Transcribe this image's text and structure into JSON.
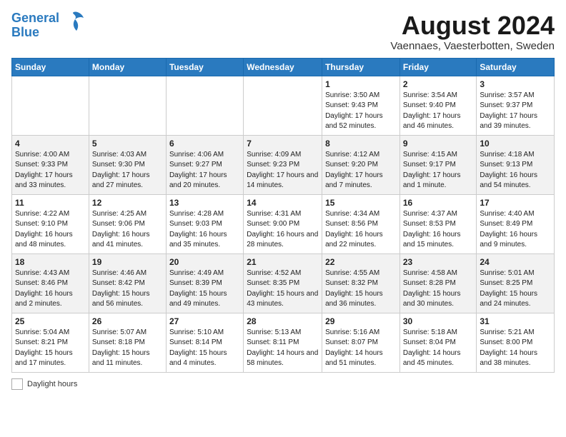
{
  "logo": {
    "line1": "General",
    "line2": "Blue",
    "symbol": "▶"
  },
  "title": "August 2024",
  "location": "Vaennaes, Vaesterbotten, Sweden",
  "days_of_week": [
    "Sunday",
    "Monday",
    "Tuesday",
    "Wednesday",
    "Thursday",
    "Friday",
    "Saturday"
  ],
  "weeks": [
    [
      {
        "day": "",
        "content": ""
      },
      {
        "day": "",
        "content": ""
      },
      {
        "day": "",
        "content": ""
      },
      {
        "day": "",
        "content": ""
      },
      {
        "day": "1",
        "content": "Sunrise: 3:50 AM\nSunset: 9:43 PM\nDaylight: 17 hours\nand 52 minutes."
      },
      {
        "day": "2",
        "content": "Sunrise: 3:54 AM\nSunset: 9:40 PM\nDaylight: 17 hours\nand 46 minutes."
      },
      {
        "day": "3",
        "content": "Sunrise: 3:57 AM\nSunset: 9:37 PM\nDaylight: 17 hours\nand 39 minutes."
      }
    ],
    [
      {
        "day": "4",
        "content": "Sunrise: 4:00 AM\nSunset: 9:33 PM\nDaylight: 17 hours\nand 33 minutes."
      },
      {
        "day": "5",
        "content": "Sunrise: 4:03 AM\nSunset: 9:30 PM\nDaylight: 17 hours\nand 27 minutes."
      },
      {
        "day": "6",
        "content": "Sunrise: 4:06 AM\nSunset: 9:27 PM\nDaylight: 17 hours\nand 20 minutes."
      },
      {
        "day": "7",
        "content": "Sunrise: 4:09 AM\nSunset: 9:23 PM\nDaylight: 17 hours\nand 14 minutes."
      },
      {
        "day": "8",
        "content": "Sunrise: 4:12 AM\nSunset: 9:20 PM\nDaylight: 17 hours\nand 7 minutes."
      },
      {
        "day": "9",
        "content": "Sunrise: 4:15 AM\nSunset: 9:17 PM\nDaylight: 17 hours\nand 1 minute."
      },
      {
        "day": "10",
        "content": "Sunrise: 4:18 AM\nSunset: 9:13 PM\nDaylight: 16 hours\nand 54 minutes."
      }
    ],
    [
      {
        "day": "11",
        "content": "Sunrise: 4:22 AM\nSunset: 9:10 PM\nDaylight: 16 hours\nand 48 minutes."
      },
      {
        "day": "12",
        "content": "Sunrise: 4:25 AM\nSunset: 9:06 PM\nDaylight: 16 hours\nand 41 minutes."
      },
      {
        "day": "13",
        "content": "Sunrise: 4:28 AM\nSunset: 9:03 PM\nDaylight: 16 hours\nand 35 minutes."
      },
      {
        "day": "14",
        "content": "Sunrise: 4:31 AM\nSunset: 9:00 PM\nDaylight: 16 hours\nand 28 minutes."
      },
      {
        "day": "15",
        "content": "Sunrise: 4:34 AM\nSunset: 8:56 PM\nDaylight: 16 hours\nand 22 minutes."
      },
      {
        "day": "16",
        "content": "Sunrise: 4:37 AM\nSunset: 8:53 PM\nDaylight: 16 hours\nand 15 minutes."
      },
      {
        "day": "17",
        "content": "Sunrise: 4:40 AM\nSunset: 8:49 PM\nDaylight: 16 hours\nand 9 minutes."
      }
    ],
    [
      {
        "day": "18",
        "content": "Sunrise: 4:43 AM\nSunset: 8:46 PM\nDaylight: 16 hours\nand 2 minutes."
      },
      {
        "day": "19",
        "content": "Sunrise: 4:46 AM\nSunset: 8:42 PM\nDaylight: 15 hours\nand 56 minutes."
      },
      {
        "day": "20",
        "content": "Sunrise: 4:49 AM\nSunset: 8:39 PM\nDaylight: 15 hours\nand 49 minutes."
      },
      {
        "day": "21",
        "content": "Sunrise: 4:52 AM\nSunset: 8:35 PM\nDaylight: 15 hours\nand 43 minutes."
      },
      {
        "day": "22",
        "content": "Sunrise: 4:55 AM\nSunset: 8:32 PM\nDaylight: 15 hours\nand 36 minutes."
      },
      {
        "day": "23",
        "content": "Sunrise: 4:58 AM\nSunset: 8:28 PM\nDaylight: 15 hours\nand 30 minutes."
      },
      {
        "day": "24",
        "content": "Sunrise: 5:01 AM\nSunset: 8:25 PM\nDaylight: 15 hours\nand 24 minutes."
      }
    ],
    [
      {
        "day": "25",
        "content": "Sunrise: 5:04 AM\nSunset: 8:21 PM\nDaylight: 15 hours\nand 17 minutes."
      },
      {
        "day": "26",
        "content": "Sunrise: 5:07 AM\nSunset: 8:18 PM\nDaylight: 15 hours\nand 11 minutes."
      },
      {
        "day": "27",
        "content": "Sunrise: 5:10 AM\nSunset: 8:14 PM\nDaylight: 15 hours\nand 4 minutes."
      },
      {
        "day": "28",
        "content": "Sunrise: 5:13 AM\nSunset: 8:11 PM\nDaylight: 14 hours\nand 58 minutes."
      },
      {
        "day": "29",
        "content": "Sunrise: 5:16 AM\nSunset: 8:07 PM\nDaylight: 14 hours\nand 51 minutes."
      },
      {
        "day": "30",
        "content": "Sunrise: 5:18 AM\nSunset: 8:04 PM\nDaylight: 14 hours\nand 45 minutes."
      },
      {
        "day": "31",
        "content": "Sunrise: 5:21 AM\nSunset: 8:00 PM\nDaylight: 14 hours\nand 38 minutes."
      }
    ]
  ],
  "footer": {
    "daylight_label": "Daylight hours"
  }
}
